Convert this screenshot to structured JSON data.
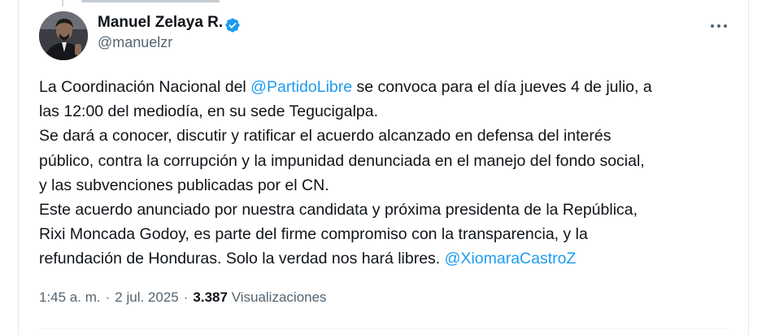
{
  "tweet": {
    "author": {
      "name": "Manuel Zelaya R.",
      "handle": "@manuelzr",
      "verified": true,
      "avatar_icon": "profile-photo"
    },
    "text": {
      "line1_before": "La Coordinación Nacional del ",
      "line1_mention": "@PartidoLibre",
      "line1_after": " se convoca para el día jueves 4 de julio, a",
      "line2": "las 12:00 del mediodía, en su sede Tegucigalpa.",
      "line3": "Se dará a conocer, discutir y ratificar el acuerdo alcanzado en defensa del interés",
      "line4": "público, contra la corrupción y la impunidad denunciada en el manejo del fondo social,",
      "line5": "y las subvenciones publicadas por el CN.",
      "line6": "Este acuerdo anunciado por nuestra candidata y próxima presidenta de la República,",
      "line7": "Rixi Moncada Godoy, es parte del firme compromiso con la transparencia, y la",
      "line8_before": "refundación de Honduras. Solo la verdad nos hará libres. ",
      "line8_mention": "@XiomaraCastroZ"
    },
    "meta": {
      "time": "1:45 a. m.",
      "separator": "·",
      "date": "2 jul. 2025",
      "views_count": "3.387",
      "views_label": "Visualizaciones"
    },
    "more_icon": "more-horizontal",
    "colors": {
      "link": "#1d9bf0",
      "text": "#0f1419",
      "secondary": "#536471",
      "verified": "#1d9bf0"
    }
  }
}
